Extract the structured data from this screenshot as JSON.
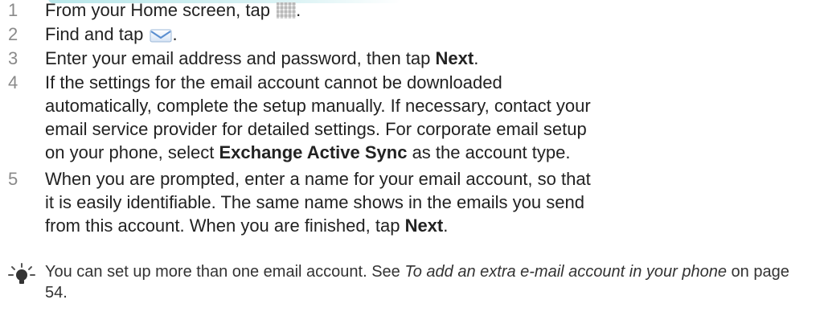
{
  "steps": [
    {
      "number": "1",
      "parts": {
        "a": "From your Home screen, tap ",
        "b": "."
      },
      "icon": "app-grid-icon"
    },
    {
      "number": "2",
      "parts": {
        "a": "Find and tap ",
        "b": "."
      },
      "icon": "email-envelope-icon"
    },
    {
      "number": "3",
      "parts": {
        "a": "Enter your email address and password, then tap ",
        "bold": "Next",
        "b": "."
      }
    },
    {
      "number": "4",
      "parts": {
        "a": "If the settings for the email account cannot be downloaded automatically, complete the setup manually. If necessary, contact your email service provider for detailed settings. For corporate email setup on your phone, select ",
        "bold": "Exchange Active Sync",
        "b": " as the account type."
      }
    },
    {
      "number": "5",
      "parts": {
        "a": "When you are prompted, enter a name for your email account, so that it is easily identifiable. The same name shows in the emails you send from this account. When you are finished, tap ",
        "bold": "Next",
        "b": "."
      }
    }
  ],
  "tip": {
    "icon": "lightbulb-tip-icon",
    "a": "You can set up more than one email account. See ",
    "link_italic": "To add an extra e-mail account in your phone",
    "b": " on page 54."
  },
  "colors": {
    "step_number": "#8a8a8a",
    "body_text": "#222222",
    "accent_top": "#7fd3d8",
    "icon_mail": "#5b8fd0"
  }
}
